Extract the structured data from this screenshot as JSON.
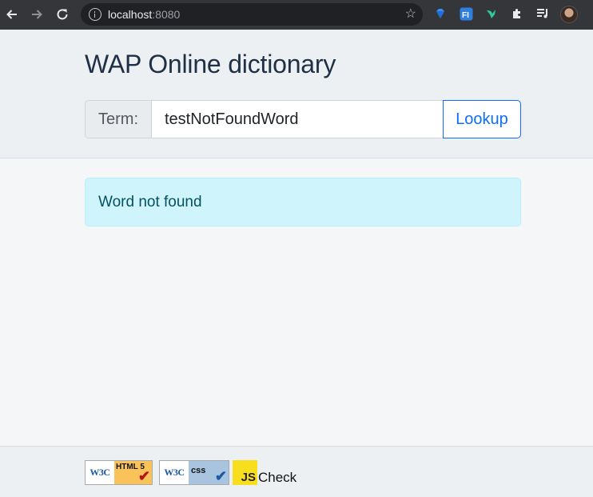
{
  "browser": {
    "url_host": "localhost",
    "url_port": ":8080"
  },
  "app": {
    "title": "WAP Online dictionary",
    "search": {
      "label": "Term:",
      "value": "testNotFoundWord",
      "button_label": "Lookup"
    },
    "alert": {
      "message": "Word not found"
    }
  },
  "footer": {
    "badges": [
      {
        "logo": "W3C",
        "text": "HTML 5"
      },
      {
        "logo": "W3C",
        "text": "css"
      },
      {
        "logo": "JS",
        "text": "Check"
      }
    ]
  },
  "colors": {
    "primary": "#0d6efd",
    "alert_bg": "#cff4fc",
    "alert_text": "#055160",
    "title": "#1f2f46"
  }
}
